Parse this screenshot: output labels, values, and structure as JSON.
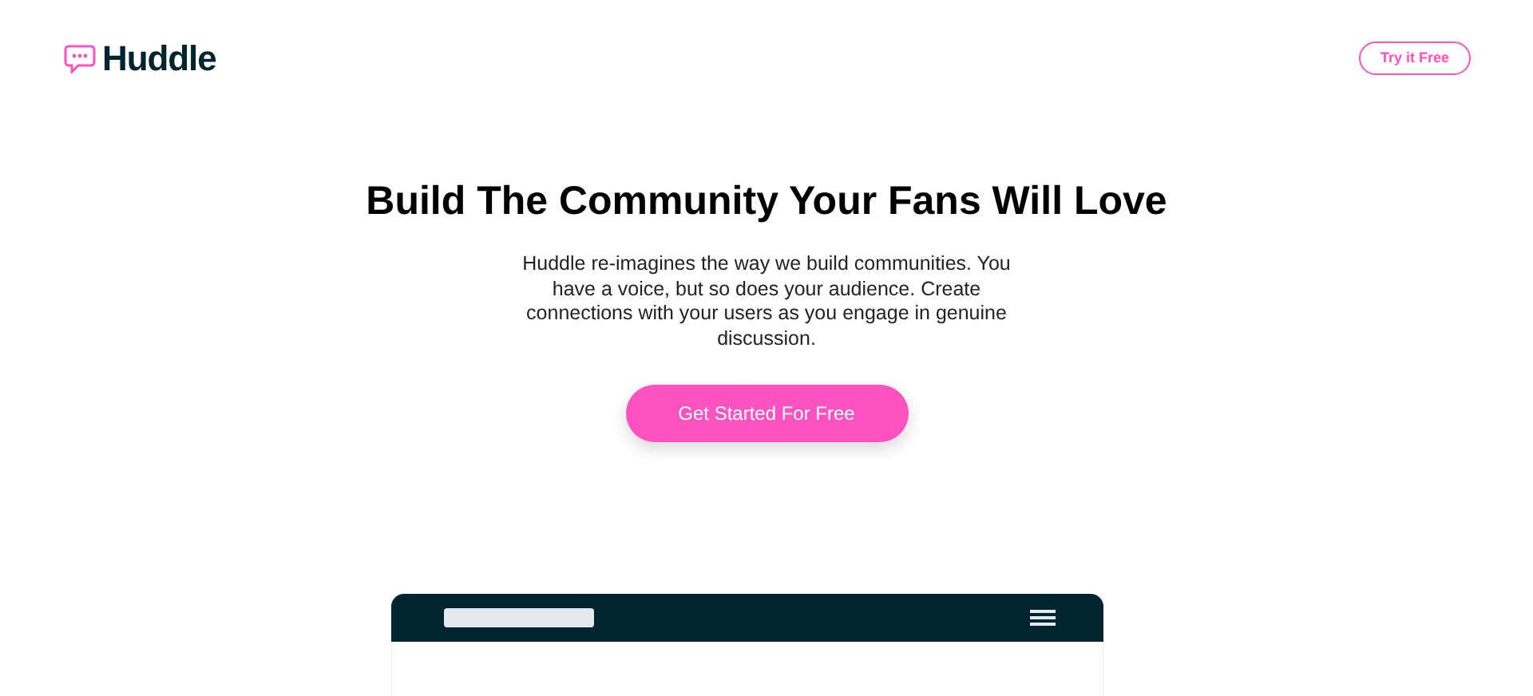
{
  "header": {
    "logo": "Huddle",
    "cta": "Try it Free"
  },
  "hero": {
    "title": "Build The Community Your Fans Will Love",
    "text": "Huddle re-imagines the way we build communities. You have a voice, but so does your audience. Create connections with your users as you engage in genuine discussion.",
    "button": "Get Started For Free"
  }
}
